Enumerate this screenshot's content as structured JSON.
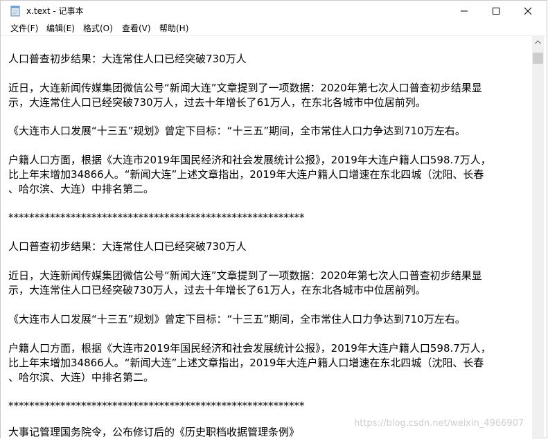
{
  "window": {
    "title": "x.text - 记事本"
  },
  "menu": [
    "文件(F)",
    "编辑(E)",
    "格式(O)",
    "查看(V)",
    "帮助(H)"
  ],
  "content": {
    "lines": [
      "人口普查初步结果：大连常住人口已经突破730万人",
      "近日，大连新闻传媒集团微信公号“新闻大连”文章提到了一项数据：2020年第七次人口普查初步结果显",
      "示，大连常住人口已经突破730万人，过去十年增长了61万人，在东北各城市中位居前列。",
      "《大连市人口发展“十三五”规划》曾定下目标：“十三五”期间，全市常住人口力争达到710万左右。",
      "户籍人口方面，根据《大连市2019年国民经济和社会发展统计公报》，2019年大连户籍人口598.7万人，",
      "比上年末增加34866人。“新闻大连”上述文章指出，2019年大连户籍人口增速在东北四城（沈阳、长春",
      "、哈尔滨、大连）中排名第二。",
      "*********************************************************",
      "人口普查初步结果：大连常住人口已经突破730万人",
      "近日，大连新闻传媒集团微信公号“新闻大连”文章提到了一项数据：2020年第七次人口普查初步结果显",
      "示，大连常住人口已经突破730万人，过去十年增长了61万人，在东北各城市中位居前列。",
      "《大连市人口发展“十三五”规划》曾定下目标：“十三五”期间，全市常住人口力争达到710万左右。",
      "户籍人口方面，根据《大连市2019年国民经济和社会发展统计公报》，2019年大连户籍人口598.7万人，",
      "比上年末增加34866人。“新闻大连”上述文章指出，2019年大连户籍人口增速在东北四城（沈阳、长春",
      "、哈尔滨、大连）中排名第二。",
      "*********************************************************",
      "大事记管理国务院令，公布修订后的《历史职档收据管理条例》"
    ]
  },
  "watermark": "https://blog.csdn.net/weixin_4966907",
  "icons": {
    "app": "notepad-icon",
    "minimize": "minimize-icon",
    "maximize": "maximize-icon",
    "close": "close-icon"
  }
}
